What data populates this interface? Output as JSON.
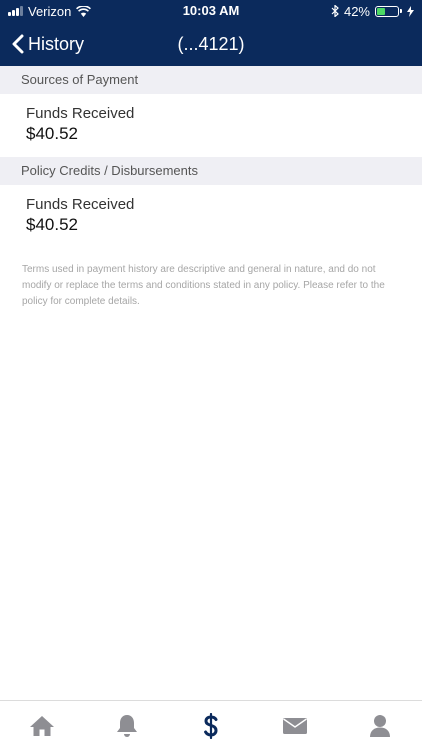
{
  "status": {
    "carrier": "Verizon",
    "time": "10:03 AM",
    "battery": "42%",
    "battery_level": 0.42
  },
  "nav": {
    "back_label": "History",
    "title": "(...4121)"
  },
  "sections": [
    {
      "header": "Sources of Payment",
      "label": "Funds Received",
      "value": "$40.52"
    },
    {
      "header": "Policy Credits / Disbursements",
      "label": "Funds Received",
      "value": "$40.52"
    }
  ],
  "disclaimer": "Terms used in payment history are descriptive and general in nature, and do not modify or replace the terms and conditions stated in any policy. Please refer to the policy for complete details.",
  "tabs": [
    {
      "icon": "home-icon"
    },
    {
      "icon": "bell-icon"
    },
    {
      "icon": "dollar-icon",
      "active": true
    },
    {
      "icon": "mail-icon"
    },
    {
      "icon": "person-icon"
    }
  ],
  "colors": {
    "header_bg": "#0b2a5c",
    "active_tab": "#0b2a5c",
    "inactive_tab": "#8e8e93",
    "section_bg": "#efeff4"
  }
}
